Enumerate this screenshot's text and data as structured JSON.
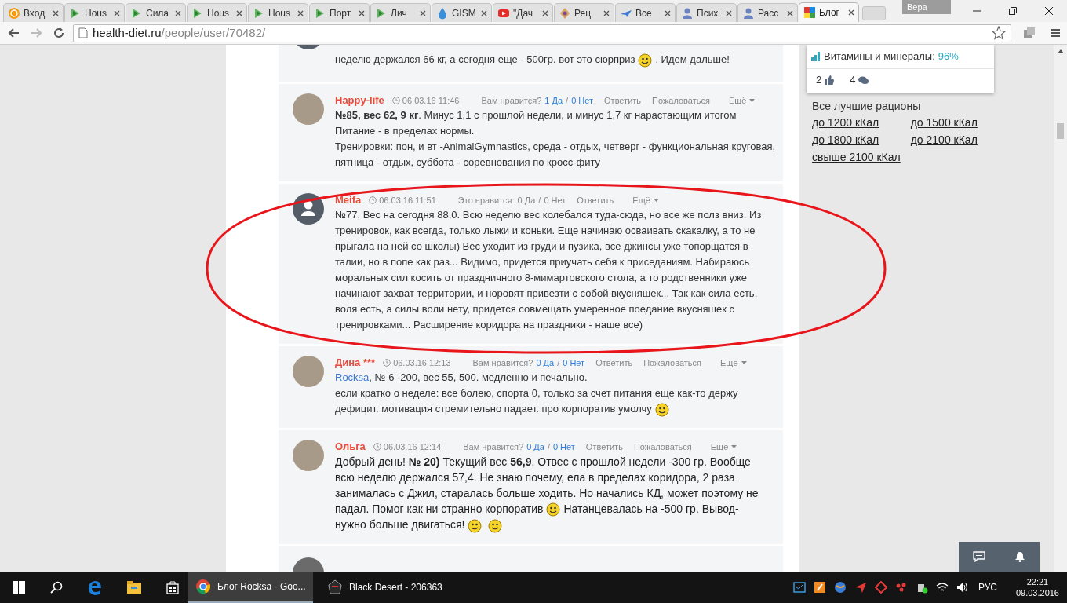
{
  "browser": {
    "tabs": [
      {
        "title": "Вход",
        "selected": false
      },
      {
        "title": "Hous",
        "selected": false
      },
      {
        "title": "Сила",
        "selected": false
      },
      {
        "title": "Hous",
        "selected": false
      },
      {
        "title": "Hous",
        "selected": false
      },
      {
        "title": "Порт",
        "selected": false
      },
      {
        "title": "Лич",
        "selected": false
      },
      {
        "title": "GISM",
        "selected": false
      },
      {
        "title": "\"Дач",
        "selected": false
      },
      {
        "title": "Рец",
        "selected": false
      },
      {
        "title": "Все",
        "selected": false
      },
      {
        "title": "Псих",
        "selected": false
      },
      {
        "title": "Расс",
        "selected": false
      },
      {
        "title": "Блог",
        "selected": true
      }
    ],
    "profile": "Вера",
    "url_host": "health-diet.ru",
    "url_path": "/people/user/70482/"
  },
  "comments": [
    {
      "kind": "partial",
      "lines": [
        [
          {
            "kind": "text",
            "text": "неделю держался 66 кг, а сегодня еще - 500гр. вот это сюрприз"
          },
          {
            "kind": "smiley"
          },
          {
            "kind": "text",
            "text": ". Идем дальше!"
          }
        ]
      ]
    },
    {
      "kind": "full",
      "author": "Happy-life",
      "avatar": {
        "kind": "photo"
      },
      "date": "06.03.16 11:46",
      "votes_label": "Вам нравится?",
      "yes": "1 Да",
      "separator": "/",
      "no": "0 Нет",
      "votes_active": true,
      "actions": [
        "Ответить",
        "Пожаловаться"
      ],
      "more": "Ещё",
      "large": false,
      "lines": [
        [
          {
            "kind": "text",
            "text": "**№85, вес 62, 9 кг**. Минус 1,1 с прошлой недели, и минус 1,7 кг нарастающим итогом"
          }
        ],
        [
          {
            "kind": "text",
            "text": "Питание - в пределах нормы."
          }
        ],
        [
          {
            "kind": "text",
            "text": "Тренировки: пон, и вт -AnimalGymnastics, среда - отдых, четверг - функциональная круговая,"
          }
        ],
        [
          {
            "kind": "text",
            "text": "пятница - отдых, суббота - соревнования по кросс-фиту"
          }
        ]
      ]
    },
    {
      "kind": "full",
      "author": "Meifa",
      "avatar": {
        "kind": "default"
      },
      "date": "06.03.16 11:51",
      "votes_label": "Это нравится:",
      "yes": "0 Да",
      "separator": "/",
      "no": "0 Нет",
      "votes_active": false,
      "actions": [
        "Ответить"
      ],
      "more": "Ещё",
      "large": false,
      "lines": [
        [
          {
            "kind": "text",
            "text": "№77, Вес на сегодня 88,0. Всю неделю вес колебался туда-сюда, но все же полз вниз. Из"
          }
        ],
        [
          {
            "kind": "text",
            "text": "тренировок, как всегда, только лыжи и коньки. Еще начинаю осваивать скакалку, а то не"
          }
        ],
        [
          {
            "kind": "text",
            "text": "прыгала на ней со школы) Вес уходит из груди и пузика, все джинсы уже топорщатся в"
          }
        ],
        [
          {
            "kind": "text",
            "text": "талии, но в попе как раз... Видимо, придется приучать себя к приседаниям. Набираюсь"
          }
        ],
        [
          {
            "kind": "text",
            "text": "моральных сил косить от праздничного 8-мимартовского стола, а то родственники уже"
          }
        ],
        [
          {
            "kind": "text",
            "text": "начинают захват территории, и норовят привезти с собой вкусняшек... Так как сила есть,"
          }
        ],
        [
          {
            "kind": "text",
            "text": "воля есть, а силы воли нету, придется совмещать умеренное поедание вкусняшек с"
          }
        ],
        [
          {
            "kind": "text",
            "text": "тренировками... Расширение коридора на праздники - наше все)"
          }
        ]
      ]
    },
    {
      "kind": "full",
      "author": "Дина ***",
      "avatar": {
        "kind": "photo"
      },
      "date": "06.03.16 12:13",
      "votes_label": "Вам нравится?",
      "yes": "0 Да",
      "separator": "/",
      "no": "0 Нет",
      "votes_active": true,
      "actions": [
        "Ответить",
        "Пожаловаться"
      ],
      "more": "Ещё",
      "large": false,
      "lines": [
        [
          {
            "kind": "link",
            "text": "Rocksa"
          },
          {
            "kind": "text",
            "text": ", № 6 -200, вес 55, 500. медленно и печально."
          }
        ],
        [
          {
            "kind": "text",
            "text": "если кратко о неделе: все болею, спорта 0, только за счет питания еще как-то держу"
          }
        ],
        [
          {
            "kind": "text",
            "text": "дефицит. мотивация стремительно падает. про корпоратив умолчу"
          },
          {
            "kind": "smiley"
          }
        ]
      ]
    },
    {
      "kind": "full",
      "author": "Ольга",
      "avatar": {
        "kind": "photo"
      },
      "date": "06.03.16 12:14",
      "votes_label": "Вам нравится?",
      "yes": "0 Да",
      "separator": "/",
      "no": "0 Нет",
      "votes_active": true,
      "actions": [
        "Ответить",
        "Пожаловаться"
      ],
      "more": "Ещё",
      "large": true,
      "lines": [
        [
          {
            "kind": "text",
            "text": "Добрый день! **№ 20)** Текущий вес **56,9**. Отвес с прошлой недели -300 гр. Вообще"
          }
        ],
        [
          {
            "kind": "text",
            "text": "всю неделю держался 57,4. Не знаю почему, ела в пределах коридора, 2 раза"
          }
        ],
        [
          {
            "kind": "text",
            "text": "занималась с Джил, старалась больше ходить. Но начались КД, может поэтому не"
          }
        ],
        [
          {
            "kind": "text",
            "text": "падал. Помог как ни странно корпоратив"
          },
          {
            "kind": "smiley"
          },
          {
            "kind": "text",
            "text": "Натанцевалась на -500 гр. Вывод-"
          }
        ],
        [
          {
            "kind": "text",
            "text": "нужно больше двигаться!"
          },
          {
            "kind": "smiley"
          },
          {
            "kind": "smiley"
          }
        ]
      ]
    },
    {
      "kind": "cut"
    }
  ],
  "sidebar": {
    "vitamins_label": "Витамины и минералы:",
    "vitamins_value": "96%",
    "likes": "2",
    "comments": "4",
    "rations_title": "Все лучшие рационы",
    "ration_links": [
      "до 1200 кКал",
      "до 1500 кКал",
      "до 1800 кКал",
      "до 2100 кКал",
      "свыше 2100 кКал"
    ]
  },
  "taskbar": {
    "apps": [
      {
        "title": "Блог Rocksa - Goo...",
        "selected": true
      },
      {
        "title": "Black Desert - 206363",
        "selected": false
      }
    ],
    "language": "РУС",
    "time": "22:21",
    "date": "09.03.2016"
  }
}
